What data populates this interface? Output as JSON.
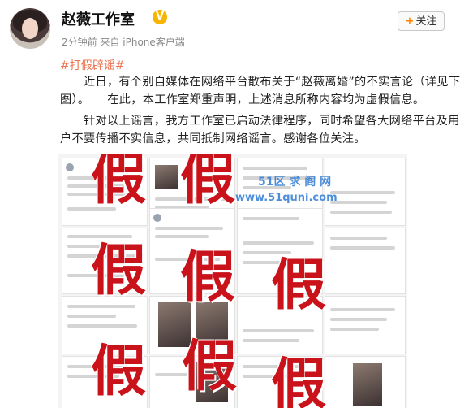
{
  "header": {
    "name": "赵薇工作室",
    "verified_badge": "V",
    "meta": "2分钟前 来自 iPhone客户端",
    "follow_label": "关注",
    "follow_plus": "+"
  },
  "post": {
    "hashtag": "#打假辟谣#",
    "paragraph1": "　　近日，有个别自媒体在网络平台散布关于“赵薇离婚”的不实言论（详见下图）。　　在此，本工作室郑重声明，上述消息所称内容均为虚假信息。",
    "paragraph2": "　　针对以上谣言，我方工作室已启动法律程序，同时希望各大网络平台及用户不要传播不实信息，共同抵制网络谣言。感谢各位关注。"
  },
  "image": {
    "stamp": "假",
    "watermark_line1": "51区 求 阁 网",
    "watermark_line2": "www.51quni.com"
  },
  "colors": {
    "hashtag": "#eb7350",
    "stamp": "#c9121a",
    "verified": "#f7b500",
    "follow_plus": "#ff8200"
  }
}
